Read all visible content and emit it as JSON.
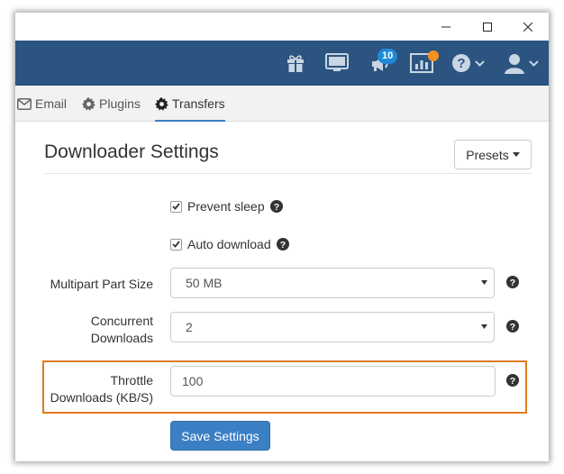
{
  "window_controls": {
    "minimize": "minimize",
    "maximize": "maximize",
    "close": "close"
  },
  "appbar": {
    "icons": [
      "gift-icon",
      "monitor-icon",
      "megaphone-icon",
      "stats-icon",
      "help-icon",
      "user-icon"
    ],
    "notification_count": "10",
    "accent_color": "#2b5480",
    "badge_color": "#1f8ad8",
    "dot_color": "#f5901e"
  },
  "tabs": [
    {
      "label": "Email",
      "icon": "envelope-icon"
    },
    {
      "label": "Plugins",
      "icon": "gear-icon"
    },
    {
      "label": "Transfers",
      "icon": "gear-icon",
      "active": true
    }
  ],
  "page": {
    "title": "Downloader Settings",
    "presets_label": "Presets"
  },
  "settings": {
    "prevent_sleep": {
      "label": "Prevent sleep",
      "checked": true
    },
    "auto_download": {
      "label": "Auto download",
      "checked": true
    },
    "multipart_part_size": {
      "label": "Multipart Part Size",
      "value": "50 MB"
    },
    "concurrent_downloads": {
      "label_line1": "Concurrent",
      "label_line2": "Downloads",
      "value": "2"
    },
    "throttle_downloads": {
      "label_line1": "Throttle",
      "label_line2": "Downloads (KB/S)",
      "value": "100"
    }
  },
  "save_label": "Save Settings",
  "highlight_color": "#e07b1a",
  "primary_color": "#3b7fc4"
}
